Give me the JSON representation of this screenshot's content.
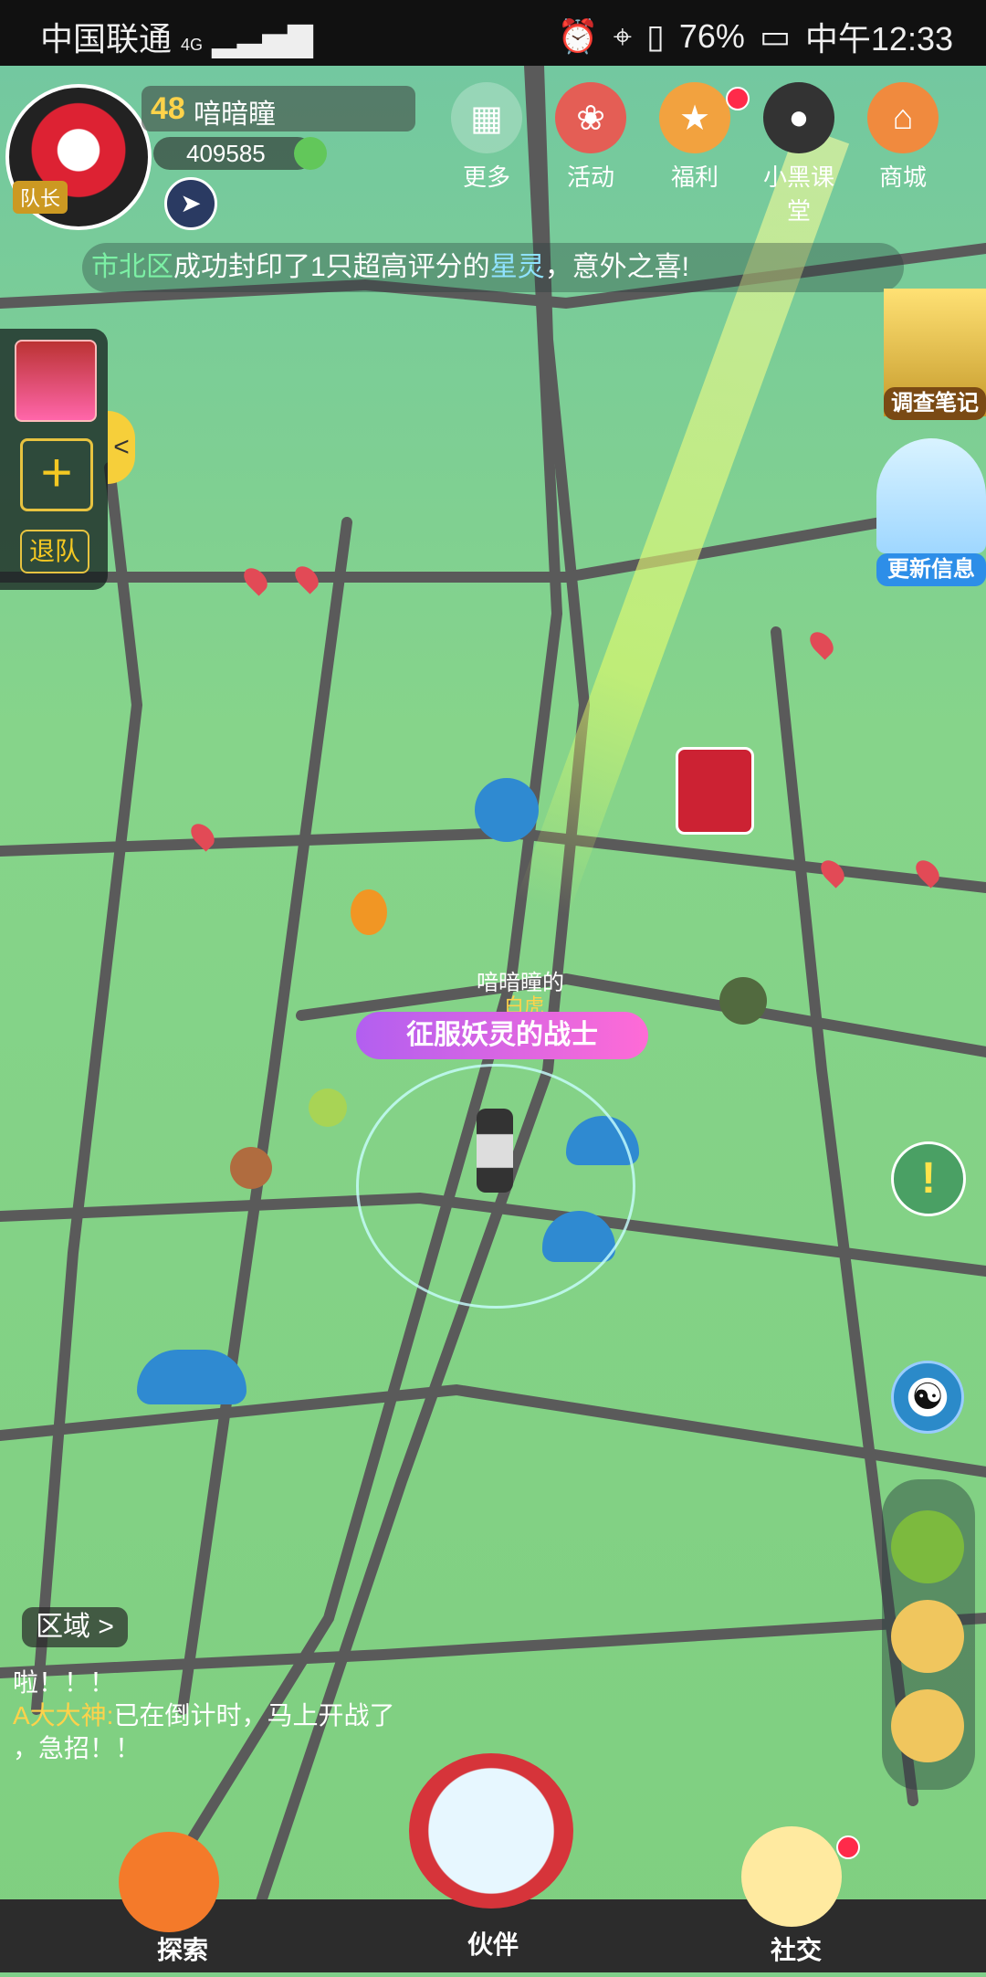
{
  "statusbar": {
    "carrier": "中国联通",
    "network": "4G",
    "battery": "76%",
    "time": "中午12:33"
  },
  "player": {
    "level": "48",
    "name": "喑暗瞳",
    "coins": "409585",
    "captain_badge": "队长"
  },
  "top_menu": [
    {
      "label": "更多",
      "icon": "grid-icon"
    },
    {
      "label": "活动",
      "icon": "lion-dance-icon"
    },
    {
      "label": "福利",
      "icon": "gift-box-icon"
    },
    {
      "label": "小黑课堂",
      "icon": "black-creature-icon"
    },
    {
      "label": "商城",
      "icon": "shop-icon"
    }
  ],
  "ticker": {
    "district": "市北区",
    "text1": "成功封印了1只超高评分的",
    "highlight": "星灵",
    "text2": "，意外之喜!"
  },
  "team": {
    "add_label": "+",
    "quit_label": "退队",
    "collapse_label": "<"
  },
  "side_buttons": {
    "notebook": "调查笔记",
    "update": "更新信息"
  },
  "character": {
    "owner_label": "喑暗瞳的",
    "pet_label": "白虎",
    "title_tag": "征服妖灵的战士"
  },
  "region_button": "区域 >",
  "chat": {
    "line1": "啦！！！",
    "speaker": "A大大神:",
    "line2": "已在倒计时，马上开战了",
    "line3": "，急招！！"
  },
  "bottom_nav": [
    {
      "label": "探索",
      "icon": "map-pin-icon"
    },
    {
      "label": "伙伴",
      "icon": "companion-icon"
    },
    {
      "label": "社交",
      "icon": "social-icon"
    }
  ]
}
